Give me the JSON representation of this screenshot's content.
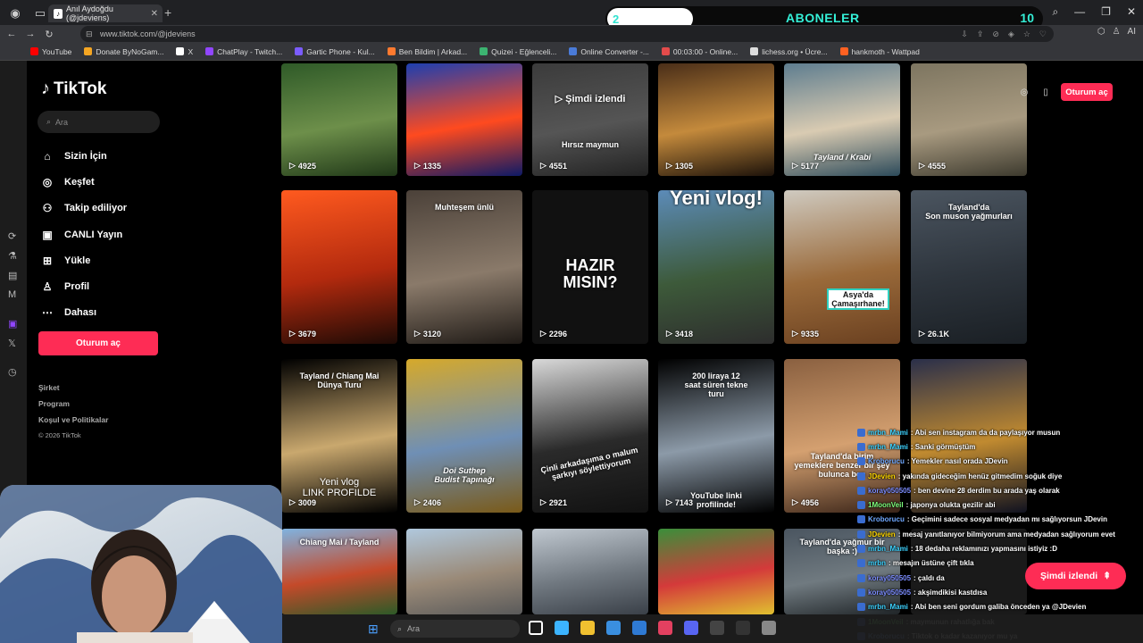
{
  "browser": {
    "tab_title": "Anıl Aydoğdu (@jdeviens)",
    "tab_close": "✕",
    "new_tab": "+",
    "url": "www.tiktok.com/@jdeviens",
    "win_controls": [
      "⌕",
      "—",
      "❐",
      "✕"
    ],
    "extensions_label": "AI"
  },
  "subs_overlay": {
    "current": "2",
    "title": "ABONELER",
    "goal": "10"
  },
  "bookmarks": [
    {
      "label": "YouTube",
      "color": "#ff0000"
    },
    {
      "label": "Donate ByNoGam...",
      "color": "#f5a623"
    },
    {
      "label": "X",
      "color": "#ffffff"
    },
    {
      "label": "ChatPlay - Twitch...",
      "color": "#9146ff"
    },
    {
      "label": "Gartic Phone - Kul...",
      "color": "#7b5cff"
    },
    {
      "label": "Ben Bildim | Arkad...",
      "color": "#ff7a2f"
    },
    {
      "label": "Quizei - Eğlenceli...",
      "color": "#3cb371"
    },
    {
      "label": "Online Converter -...",
      "color": "#4a7bd9"
    },
    {
      "label": "00:03:00 - Online...",
      "color": "#e34b4b"
    },
    {
      "label": "lichess.org • Ücre...",
      "color": "#dddddd"
    },
    {
      "label": "hankmoth - Wattpad",
      "color": "#ff6122"
    }
  ],
  "tiktok": {
    "logo": "TikTok",
    "search_placeholder": "Ara",
    "nav": [
      {
        "icon": "⌂",
        "label": "Sizin İçin"
      },
      {
        "icon": "◎",
        "label": "Keşfet"
      },
      {
        "icon": "⚇",
        "label": "Takip ediliyor"
      },
      {
        "icon": "▣",
        "label": "CANLI Yayın"
      },
      {
        "icon": "⊞",
        "label": "Yükle"
      },
      {
        "icon": "♙",
        "label": "Profil"
      },
      {
        "icon": "⋯",
        "label": "Dahası"
      }
    ],
    "login_label": "Oturum aç",
    "footer": [
      "Şirket",
      "Program",
      "Koşul ve Politikalar",
      "© 2026 TikTok"
    ],
    "top_login_label": "Oturum aç",
    "watch_now_label": "Şimdi izlendi",
    "watch_now_icon": "⇞"
  },
  "videos": [
    {
      "views": "4925",
      "caption": "",
      "colors": [
        "#2f5a28",
        "#6d8f4a",
        "#203818"
      ]
    },
    {
      "views": "1335",
      "caption": "",
      "colors": [
        "#1d3fb0",
        "#ff4a1f",
        "#0d1a66"
      ]
    },
    {
      "views": "4551",
      "caption": "▷ Şimdi izlendi",
      "sub": "Hırsız maymun",
      "colors": [
        "#3b3b3b",
        "#555",
        "#222"
      ]
    },
    {
      "views": "1305",
      "caption": "",
      "colors": [
        "#4a2e18",
        "#c48a3c",
        "#1c120a"
      ]
    },
    {
      "views": "5177",
      "caption": "Tayland / Krabi",
      "colors": [
        "#5e7d8f",
        "#d9cbb2",
        "#2c4a5a"
      ]
    },
    {
      "views": "4555",
      "caption": "",
      "colors": [
        "#7d7560",
        "#a89a80",
        "#3d3a2e"
      ]
    },
    {
      "views": "3679",
      "caption": "",
      "colors": [
        "#ff5a1f",
        "#b32a0e",
        "#1d0a05"
      ]
    },
    {
      "views": "3120",
      "caption": "Muhteşem ünlü",
      "colors": [
        "#4b4139",
        "#8a7a6a",
        "#1f1a16"
      ]
    },
    {
      "views": "2296",
      "caption": "HAZIR\nMISIN?",
      "colors": [
        "#111111",
        "#111111",
        "#111111"
      ]
    },
    {
      "views": "3418",
      "caption": "Yeni vlog!",
      "colors": [
        "#5c8bb8",
        "#3d5a3a",
        "#2d2d2d"
      ]
    },
    {
      "views": "9335",
      "caption": "Asya'da Çamaşırhane!",
      "colors": [
        "#cfcac0",
        "#9a6a3a",
        "#6a4020"
      ]
    },
    {
      "views": "26.1K",
      "caption": "Tayland'da\nSon muson yağmurları",
      "colors": [
        "#4b5560",
        "#2d343c",
        "#1a1f24"
      ]
    },
    {
      "views": "3009",
      "caption": "Tayland / Chiang Mai\nDünya Turu",
      "sub": "Yeni vlog\nLINK PROFILDE",
      "colors": [
        "#000000",
        "#c9a86e",
        "#000000"
      ]
    },
    {
      "views": "2406",
      "caption": "Doi Suthep\nBudist Tapınağı",
      "colors": [
        "#d6a92a",
        "#6f8fb5",
        "#7a5a18"
      ]
    },
    {
      "views": "2921",
      "caption": "Çinli arkadaşıma o malum\nşarkıyı söylettiyorum",
      "colors": [
        "#d9d9d9",
        "#2a2a2a",
        "#111111"
      ]
    },
    {
      "views": "7143",
      "caption": "200 liraya 12\nsaat süren tekne\nturu",
      "sub": "YouTube linki\nprofilinde!",
      "colors": [
        "#000000",
        "#8c9aa8",
        "#000000"
      ]
    },
    {
      "views": "4956",
      "caption": "Tayland'da birim\nyemeklere benzer bir şey\nbulunca ben",
      "colors": [
        "#8a6040",
        "#d4a070",
        "#3a2418"
      ]
    },
    {
      "views": "",
      "caption": "",
      "colors": [
        "#2a2f4a",
        "#c08a30",
        "#101220"
      ]
    },
    {
      "views": "",
      "caption": "Chiang Mai / Tayland",
      "colors": [
        "#7fb3e0",
        "#c44a2a",
        "#2d5a28"
      ]
    },
    {
      "views": "",
      "caption": "",
      "colors": [
        "#b0c8dd",
        "#9a8a78",
        "#5a5a5a"
      ]
    },
    {
      "views": "",
      "caption": "",
      "colors": [
        "#c0c8d0",
        "#707880",
        "#3a4048"
      ]
    },
    {
      "views": "",
      "caption": "",
      "colors": [
        "#3a8f3a",
        "#d43a3a",
        "#e0c030"
      ]
    },
    {
      "views": "",
      "caption": "Tayland'da yağmur bir\nbaşka :)",
      "colors": [
        "#4a5560",
        "#707a80",
        "#202528"
      ]
    },
    {
      "views": "",
      "caption": "",
      "colors": [
        "#1a1a1a",
        "#1a1a1a",
        "#1a1a1a"
      ]
    }
  ],
  "chat": [
    {
      "user": "mrbn_Mami",
      "color": "#3cd2ff",
      "text": ": Abi sen instagram da da paylaşıyor musun"
    },
    {
      "user": "mrbn_Mami",
      "color": "#3cd2ff",
      "text": ": Sanki görmüştüm"
    },
    {
      "user": "Kroborucu",
      "color": "#6fa8ff",
      "text": ": Yemekler nasıl orada JDevin"
    },
    {
      "user": "JDevien",
      "color": "#ffd700",
      "text": ": yakında gideceğim henüz gitmedim soğuk diye"
    },
    {
      "user": "koray050505",
      "color": "#7b8cff",
      "text": ": ben devine 28 derdim bu arada yaş olarak"
    },
    {
      "user": "1MoonVeil",
      "color": "#7dff7d",
      "text": ": japonya olukta gezilir abi"
    },
    {
      "user": "Kroborucu",
      "color": "#6fa8ff",
      "text": ": Geçimini sadece sosyal medyadan mı sağlıyorsun JDevin"
    },
    {
      "user": "JDevien",
      "color": "#ffd700",
      "text": ": mesaj yanıtlanıyor bilmiyorum ama medyadan sağlıyorum evet"
    },
    {
      "user": "mrbn_Mami",
      "color": "#3cd2ff",
      "text": ": 18 dedaha reklamınızı yapmasını istiyiz :D"
    },
    {
      "user": "mrbn",
      "color": "#3cd2ff",
      "text": ": mesajın üstüne çift tıkla"
    },
    {
      "user": "koray050505",
      "color": "#7b8cff",
      "text": ": çaldı da"
    },
    {
      "user": "koray050505",
      "color": "#7b8cff",
      "text": ": akşimdikisi kastdısa"
    },
    {
      "user": "mrbn_Mami",
      "color": "#3cd2ff",
      "text": ": Abi ben seni gordum galiba önceden ya @JDevien"
    },
    {
      "user": "1MoonVeil",
      "color": "#7dff7d",
      "text": ": maymunun rahatlığa bak"
    },
    {
      "user": "Kroborucu",
      "color": "#6fa8ff",
      "text": ": Tiktok o kadar kazanıyor mu ya"
    }
  ],
  "taskbar": {
    "search_placeholder": "Ara",
    "clock_time": "",
    "app_colors": [
      "#ffffff",
      "#3cb4ff",
      "#f0c030",
      "#3a8fe0",
      "#2f7ad4",
      "#e34060",
      "#5865f2",
      "#444444",
      "#333333",
      "#888888"
    ]
  }
}
